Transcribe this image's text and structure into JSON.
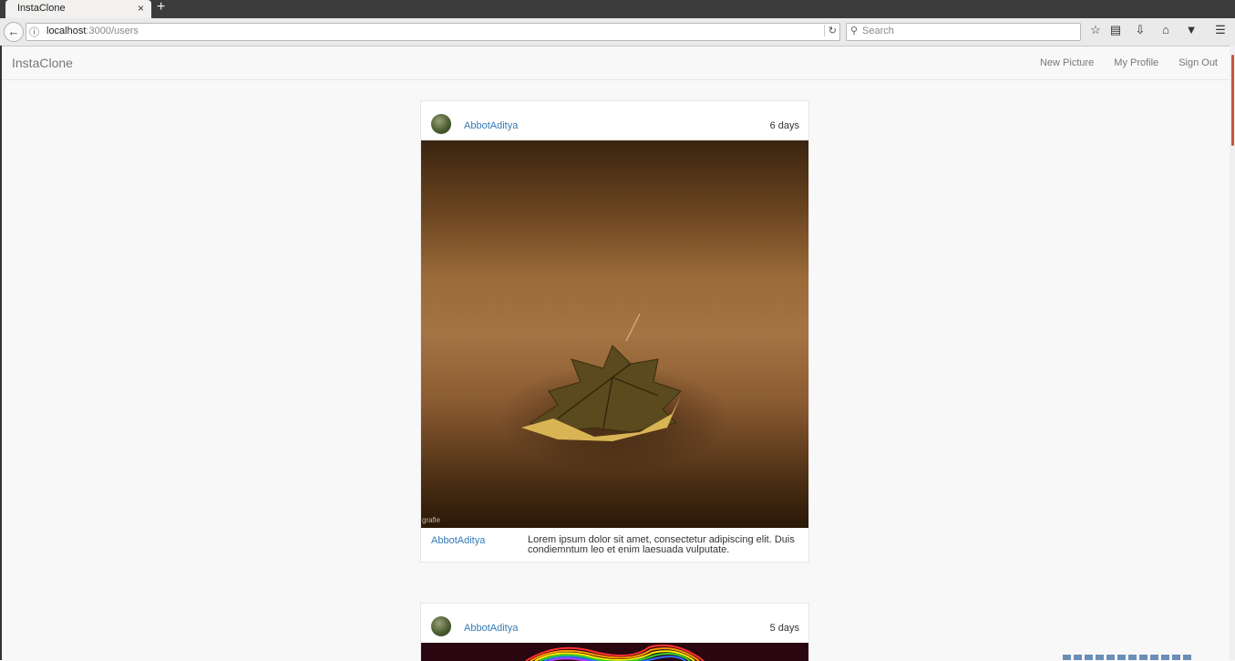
{
  "browser": {
    "tab_title": "InstaClone",
    "tab_close": "×",
    "new_tab": "+",
    "url_host": "localhost",
    "url_path": ":3000/users",
    "search_placeholder": "Search"
  },
  "app": {
    "brand": "InstaClone",
    "nav": {
      "new_picture": "New Picture",
      "my_profile": "My Profile",
      "sign_out": "Sign Out"
    }
  },
  "posts": [
    {
      "author": "AbbotAditya",
      "age": "6 days",
      "photo_watermark": "grafie",
      "caption_user": "AbbotAditya",
      "caption": "Lorem ipsum dolor sit amet, consectetur adipiscing elit. Duis condiemntum leo et enim laesuada vulputate."
    },
    {
      "author": "AbbotAditya",
      "age": "5 days"
    }
  ]
}
